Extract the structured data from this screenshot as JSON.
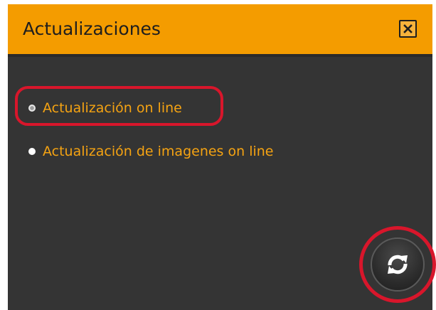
{
  "window": {
    "title": "Actualizaciones",
    "close_icon": "close-icon"
  },
  "options": [
    {
      "label": "Actualización on line",
      "selected": true,
      "highlighted": true
    },
    {
      "label": "Actualización de imagenes on line",
      "selected": false,
      "highlighted": false
    }
  ],
  "refresh_button": {
    "icon": "refresh-icon",
    "highlighted": true
  },
  "colors": {
    "title_bar": "#f49c00",
    "panel_background": "#343434",
    "option_text": "#f5a312",
    "highlight_ring": "#d8162b"
  }
}
